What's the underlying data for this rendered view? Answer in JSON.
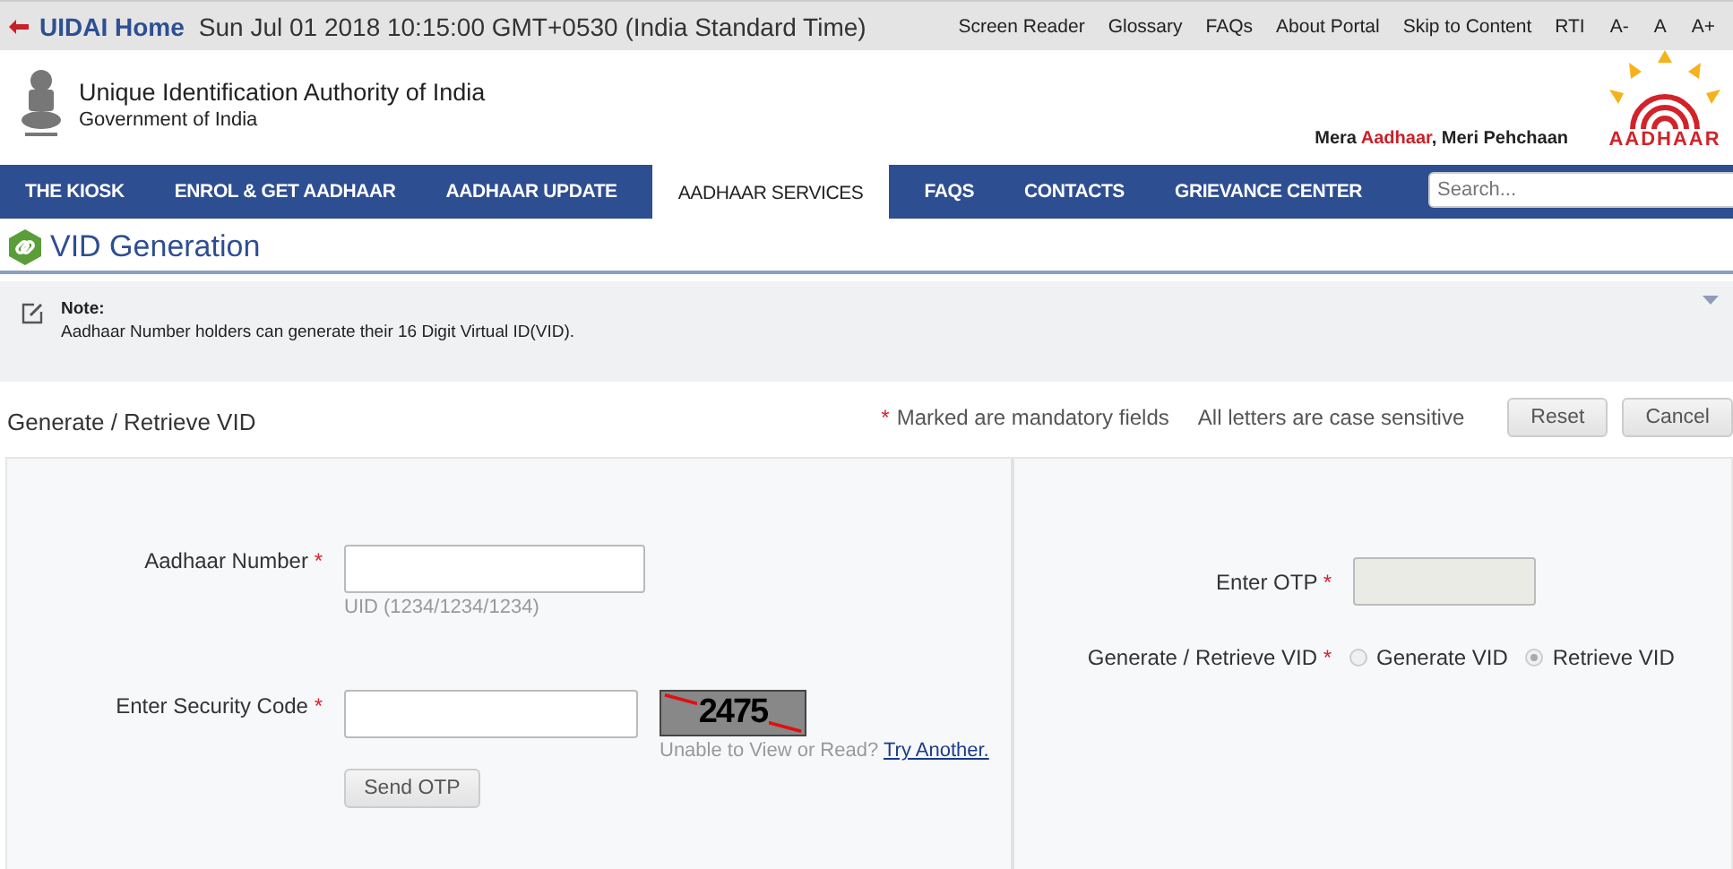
{
  "top_bar": {
    "home_link": "UIDAI Home",
    "datetime": "Sun Jul 01 2018 10:15:00 GMT+0530 (India Standard Time)",
    "links": [
      "Screen Reader",
      "Glossary",
      "FAQs",
      "About Portal",
      "Skip to Content",
      "RTI"
    ],
    "font_sizes": [
      "A-",
      "A",
      "A+"
    ]
  },
  "header": {
    "org_name": "Unique Identification Authority of India",
    "org_sub": "Government of India",
    "tagline": [
      {
        "text": "Mera ",
        "highlight": false
      },
      {
        "text": "Aadhaar",
        "highlight": true
      },
      {
        "text": ", Meri Pehchaan",
        "highlight": false
      }
    ],
    "logo_text": "AADHAAR"
  },
  "nav": {
    "items": [
      {
        "label": "THE KIOSK",
        "selected": false
      },
      {
        "label": "ENROL & GET AADHAAR",
        "selected": false
      },
      {
        "label": "AADHAAR UPDATE",
        "selected": false
      },
      {
        "label": "AADHAAR SERVICES",
        "selected": true
      },
      {
        "label": "FAQS",
        "selected": false
      },
      {
        "label": "CONTACTS",
        "selected": false
      },
      {
        "label": "GRIEVANCE CENTER",
        "selected": false
      }
    ],
    "search_placeholder": "Search..."
  },
  "page_title": "VID Generation",
  "note": {
    "heading": "Note:",
    "text": "Aadhaar Number holders can generate their 16 Digit Virtual ID(VID)."
  },
  "required_mark": "*",
  "form_header": {
    "title": "Generate / Retrieve VID",
    "mandatory": "Marked are mandatory fields",
    "case_note": "All letters are case sensitive",
    "buttons": [
      "Reset",
      "Cancel"
    ]
  },
  "form": {
    "aadhaar_label": "Aadhaar Number",
    "aadhaar_hint": "UID (1234/1234/1234)",
    "security_label": "Enter Security Code",
    "captcha": "2475",
    "captcha_help": "Unable to View or Read?",
    "captcha_link": "Try Another.",
    "send_button": "Send OTP",
    "otp_label": "Enter OTP",
    "otp_disabled": true,
    "vid_label": "Generate / Retrieve VID",
    "options": [
      {
        "label": "Generate VID",
        "selected": false,
        "disabled": true
      },
      {
        "label": "Retrieve VID",
        "selected": true,
        "disabled": true
      }
    ]
  }
}
